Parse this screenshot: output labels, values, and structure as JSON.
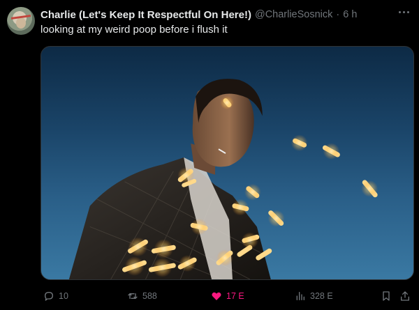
{
  "tweet": {
    "author": {
      "display_name": "Charlie (Let's Keep It Respectful On Here!)",
      "handle": "@CharlieSosnick",
      "separator": "·",
      "time": "6 h"
    },
    "text": "looking at my weird poop before i flush it",
    "actions": {
      "reply_count": "10",
      "retweet_count": "588",
      "like_count": "17 E",
      "view_count": "328 E"
    }
  },
  "icons": {
    "more": "more-dots-icon",
    "reply": "reply-icon",
    "retweet": "retweet-icon",
    "like": "heart-filled-icon",
    "views": "views-chart-icon",
    "bookmark": "bookmark-icon",
    "share": "share-icon"
  },
  "colors": {
    "background": "#000000",
    "text_primary": "#e7e9ea",
    "text_secondary": "#71767b",
    "like_active": "#f91880",
    "media_sky": "#2a5f88",
    "light_streak": "#ffd98a"
  }
}
